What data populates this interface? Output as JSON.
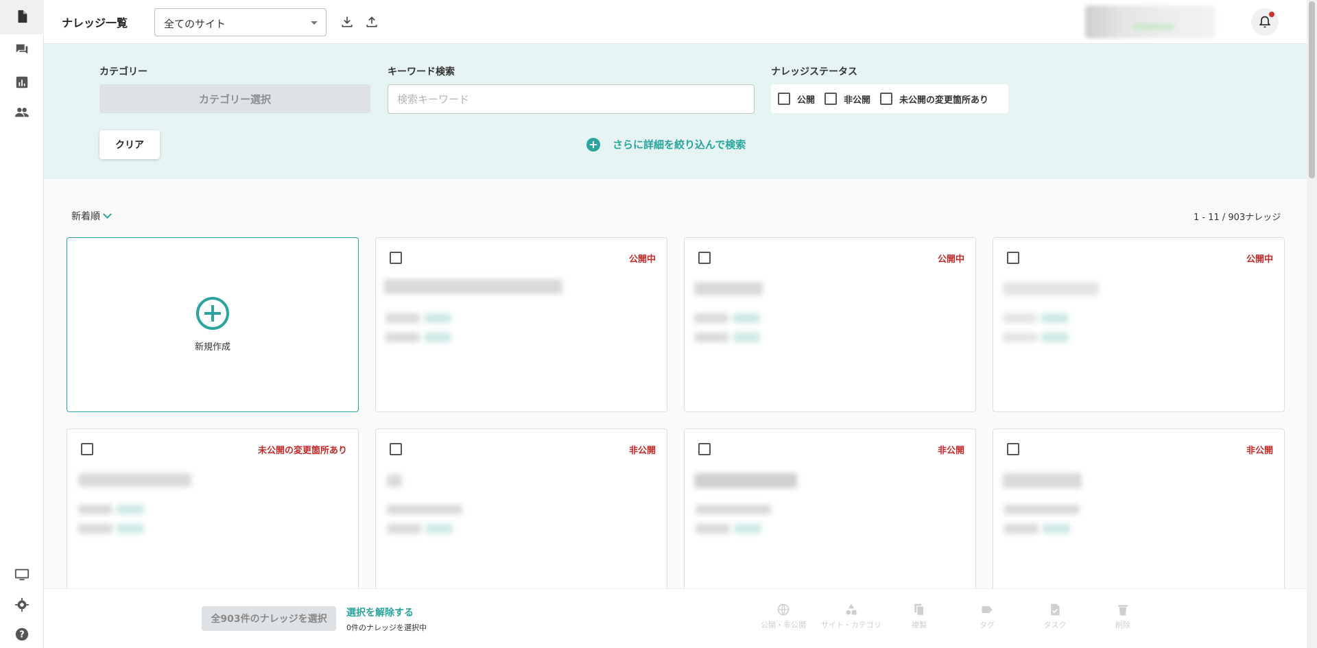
{
  "header": {
    "title": "ナレッジ一覧",
    "site_select_value": "全てのサイト"
  },
  "filter": {
    "category_label": "カテゴリー",
    "category_button": "カテゴリー選択",
    "keyword_label": "キーワード検索",
    "keyword_placeholder": "検索キーワード",
    "keyword_value": "",
    "status_label": "ナレッジステータス",
    "status_options": [
      "公開",
      "非公開",
      "未公開の変更箇所あり"
    ],
    "clear_button": "クリア",
    "more_search": "さらに詳細を絞り込んで検索"
  },
  "list": {
    "sort_label": "新着順",
    "count_text": "1 - 11 / 903ナレッジ",
    "new_card_label": "新規作成",
    "cards": [
      {
        "status": "公開中"
      },
      {
        "status": "公開中"
      },
      {
        "status": "公開中"
      },
      {
        "status": "未公開の変更箇所あり"
      },
      {
        "status": "非公開"
      },
      {
        "status": "非公開"
      },
      {
        "status": "非公開"
      }
    ]
  },
  "bottom": {
    "select_all": "全903件のナレッジを選択",
    "deselect": "選択を解除する",
    "selected_count": "0件のナレッジを選択中",
    "actions": [
      "公開・非公開",
      "サイト・カテゴリ",
      "複製",
      "タグ",
      "タスク",
      "削除"
    ]
  },
  "colors": {
    "accent": "#2aa49c",
    "status_red": "#c62828",
    "filter_bg": "#e5f4f3"
  }
}
